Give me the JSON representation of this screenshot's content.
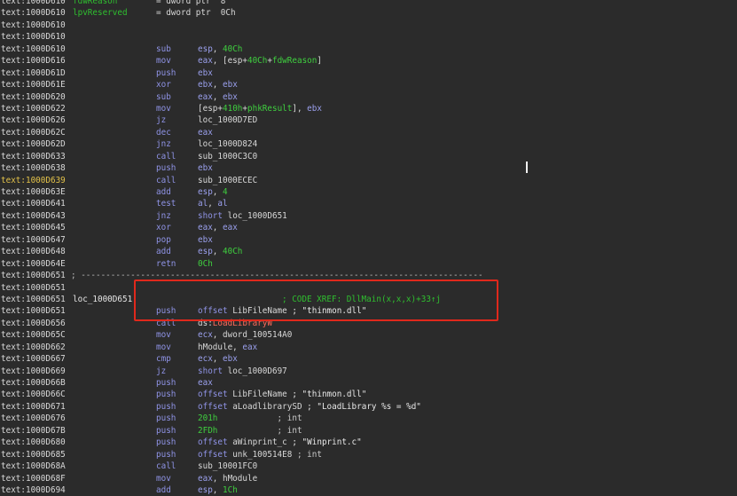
{
  "listing": [
    {
      "addr": "text:1000D610",
      "label": "fdwReason",
      "label_green": true,
      "eq": "= dword ptr  8"
    },
    {
      "addr": "text:1000D610",
      "label": "lpvReserved",
      "label_green": true,
      "eq": "= dword ptr  0Ch"
    },
    {
      "addr": "text:1000D610"
    },
    {
      "addr": "text:1000D610"
    },
    {
      "addr": "text:1000D610",
      "mn": "sub",
      "op": [
        {
          "t": "esp",
          "c": "reg"
        },
        {
          "t": ", "
        },
        {
          "t": "40Ch",
          "c": "num"
        }
      ]
    },
    {
      "addr": "text:1000D616",
      "mn": "mov",
      "op": [
        {
          "t": "eax",
          "c": "reg"
        },
        {
          "t": ", [esp+"
        },
        {
          "t": "40Ch",
          "c": "num"
        },
        {
          "t": "+"
        },
        {
          "t": "fdwReason",
          "c": "var"
        },
        {
          "t": "]"
        }
      ]
    },
    {
      "addr": "text:1000D61D",
      "mn": "push",
      "op": [
        {
          "t": "ebx",
          "c": "reg"
        }
      ]
    },
    {
      "addr": "text:1000D61E",
      "mn": "xor",
      "op": [
        {
          "t": "ebx",
          "c": "reg"
        },
        {
          "t": ", "
        },
        {
          "t": "ebx",
          "c": "reg"
        }
      ]
    },
    {
      "addr": "text:1000D620",
      "mn": "sub",
      "op": [
        {
          "t": "eax",
          "c": "reg"
        },
        {
          "t": ", "
        },
        {
          "t": "ebx",
          "c": "reg"
        }
      ]
    },
    {
      "addr": "text:1000D622",
      "mn": "mov",
      "op": [
        {
          "t": "[esp+"
        },
        {
          "t": "410h",
          "c": "num"
        },
        {
          "t": "+"
        },
        {
          "t": "phkResult",
          "c": "var"
        },
        {
          "t": "], "
        },
        {
          "t": "ebx",
          "c": "reg"
        }
      ]
    },
    {
      "addr": "text:1000D626",
      "mn": "jz",
      "op": [
        {
          "t": "loc_1000D7ED"
        }
      ]
    },
    {
      "addr": "text:1000D62C",
      "mn": "dec",
      "op": [
        {
          "t": "eax",
          "c": "reg"
        }
      ]
    },
    {
      "addr": "text:1000D62D",
      "mn": "jnz",
      "op": [
        {
          "t": "loc_1000D824"
        }
      ]
    },
    {
      "addr": "text:1000D633",
      "mn": "call",
      "op": [
        {
          "t": "sub_1000C3C0"
        }
      ]
    },
    {
      "addr": "text:1000D638",
      "mn": "push",
      "op": [
        {
          "t": "ebx",
          "c": "reg"
        }
      ]
    },
    {
      "addr": "text:1000D639",
      "hl": true,
      "mn": "call",
      "op": [
        {
          "t": "sub_1000ECEC"
        }
      ]
    },
    {
      "addr": "text:1000D63E",
      "mn": "add",
      "op": [
        {
          "t": "esp",
          "c": "reg"
        },
        {
          "t": ", "
        },
        {
          "t": "4",
          "c": "num"
        }
      ]
    },
    {
      "addr": "text:1000D641",
      "mn": "test",
      "op": [
        {
          "t": "al",
          "c": "reg"
        },
        {
          "t": ", "
        },
        {
          "t": "al",
          "c": "reg"
        }
      ]
    },
    {
      "addr": "text:1000D643",
      "mn": "jnz",
      "op": [
        {
          "t": "short ",
          "c": "kw"
        },
        {
          "t": "loc_1000D651"
        }
      ]
    },
    {
      "addr": "text:1000D645",
      "mn": "xor",
      "op": [
        {
          "t": "eax",
          "c": "reg"
        },
        {
          "t": ", "
        },
        {
          "t": "eax",
          "c": "reg"
        }
      ]
    },
    {
      "addr": "text:1000D647",
      "mn": "pop",
      "op": [
        {
          "t": "ebx",
          "c": "reg"
        }
      ]
    },
    {
      "addr": "text:1000D648",
      "mn": "add",
      "op": [
        {
          "t": "esp",
          "c": "reg"
        },
        {
          "t": ", "
        },
        {
          "t": "40Ch",
          "c": "num"
        }
      ]
    },
    {
      "addr": "text:1000D64E",
      "mn": "retn",
      "op": [
        {
          "t": "0Ch",
          "c": "num"
        }
      ]
    },
    {
      "addr": "text:1000D651",
      "sep": "; ---------------------------------------------------------------------------------"
    },
    {
      "addr": "text:1000D651"
    },
    {
      "addr": "text:1000D651",
      "label": "loc_1000D651:",
      "xref": "; CODE XREF: DllMain(x,x,x)+33↑j"
    },
    {
      "addr": "text:1000D651",
      "mn": "push",
      "op": [
        {
          "t": "offset ",
          "c": "kw"
        },
        {
          "t": "LibFileName"
        },
        {
          "t": " ; \"thinmon.dll\"",
          "c": "str"
        }
      ]
    },
    {
      "addr": "text:1000D656",
      "mn": "call",
      "op": [
        {
          "t": "ds:"
        },
        {
          "t": "LoadLibraryW",
          "c": "imp"
        }
      ]
    },
    {
      "addr": "text:1000D65C",
      "mn": "mov",
      "op": [
        {
          "t": "ecx",
          "c": "reg"
        },
        {
          "t": ", "
        },
        {
          "t": "dword_100514A0"
        }
      ]
    },
    {
      "addr": "text:1000D662",
      "mn": "mov",
      "op": [
        {
          "t": "hModule, "
        },
        {
          "t": "eax",
          "c": "reg"
        }
      ]
    },
    {
      "addr": "text:1000D667",
      "mn": "cmp",
      "op": [
        {
          "t": "ecx",
          "c": "reg"
        },
        {
          "t": ", "
        },
        {
          "t": "ebx",
          "c": "reg"
        }
      ]
    },
    {
      "addr": "text:1000D669",
      "mn": "jz",
      "op": [
        {
          "t": "short ",
          "c": "kw"
        },
        {
          "t": "loc_1000D697"
        }
      ]
    },
    {
      "addr": "text:1000D66B",
      "mn": "push",
      "op": [
        {
          "t": "eax",
          "c": "reg"
        }
      ]
    },
    {
      "addr": "text:1000D66C",
      "mn": "push",
      "op": [
        {
          "t": "offset ",
          "c": "kw"
        },
        {
          "t": "LibFileName"
        },
        {
          "t": " ; \"thinmon.dll\"",
          "c": "str"
        }
      ]
    },
    {
      "addr": "text:1000D671",
      "mn": "push",
      "op": [
        {
          "t": "offset ",
          "c": "kw"
        },
        {
          "t": "aLoadlibrarySD"
        },
        {
          "t": " ; \"LoadLibrary %s = %d\"",
          "c": "str"
        }
      ]
    },
    {
      "addr": "text:1000D676",
      "mn": "push",
      "op": [
        {
          "t": "201h",
          "c": "num"
        },
        {
          "t": "            ; int",
          "c": "cmt"
        }
      ]
    },
    {
      "addr": "text:1000D67B",
      "mn": "push",
      "op": [
        {
          "t": "2FDh",
          "c": "num"
        },
        {
          "t": "            ; int",
          "c": "cmt"
        }
      ]
    },
    {
      "addr": "text:1000D680",
      "mn": "push",
      "op": [
        {
          "t": "offset ",
          "c": "kw"
        },
        {
          "t": "aWinprint_c"
        },
        {
          "t": " ; \"Winprint.c\"",
          "c": "str"
        }
      ]
    },
    {
      "addr": "text:1000D685",
      "mn": "push",
      "op": [
        {
          "t": "offset ",
          "c": "kw"
        },
        {
          "t": "unk_100514E8"
        },
        {
          "t": " ; int",
          "c": "cmt"
        }
      ]
    },
    {
      "addr": "text:1000D68A",
      "mn": "call",
      "op": [
        {
          "t": "sub_10001FC0"
        }
      ]
    },
    {
      "addr": "text:1000D68F",
      "mn": "mov",
      "op": [
        {
          "t": "eax",
          "c": "reg"
        },
        {
          "t": ", hModule"
        }
      ]
    },
    {
      "addr": "text:1000D694",
      "mn": "add",
      "op": [
        {
          "t": "esp",
          "c": "reg"
        },
        {
          "t": ", "
        },
        {
          "t": "1Ch",
          "c": "num"
        }
      ]
    }
  ]
}
